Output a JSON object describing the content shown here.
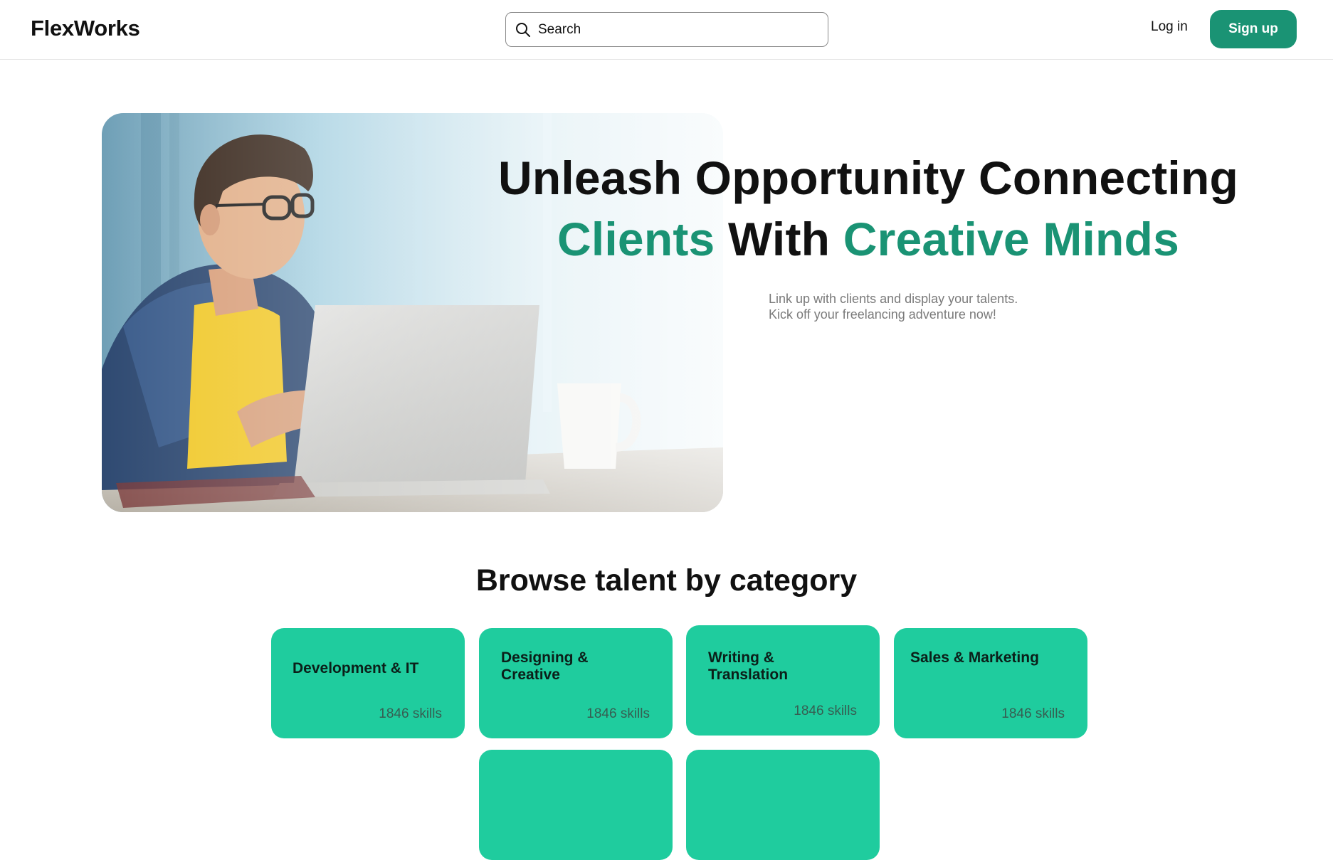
{
  "header": {
    "logo": "FlexWorks",
    "search_placeholder": "Search",
    "login_label": "Log in",
    "signup_label": "Sign up"
  },
  "hero": {
    "title_line1": "Unleash Opportunity Connecting",
    "title_clients": "Clients",
    "title_with": "With",
    "title_creative": "Creative Minds",
    "subtitle_line1": "Link up with clients and display your talents.",
    "subtitle_line2": "Kick off your freelancing adventure now!"
  },
  "categories": {
    "heading": "Browse talent by category",
    "items": [
      {
        "title": "Development & IT",
        "count": "1846 skills"
      },
      {
        "title_line1": "Designing &",
        "title_line2": "Creative",
        "count": "1846 skills"
      },
      {
        "title_line1": "Writing &",
        "title_line2": "Translation",
        "count": "1846 skills"
      },
      {
        "title": "Sales & Marketing",
        "count": "1846 skills"
      }
    ]
  },
  "colors": {
    "brand_green": "#1a9374",
    "card_green": "#1fcc9e"
  },
  "icons": [
    "search-icon"
  ]
}
